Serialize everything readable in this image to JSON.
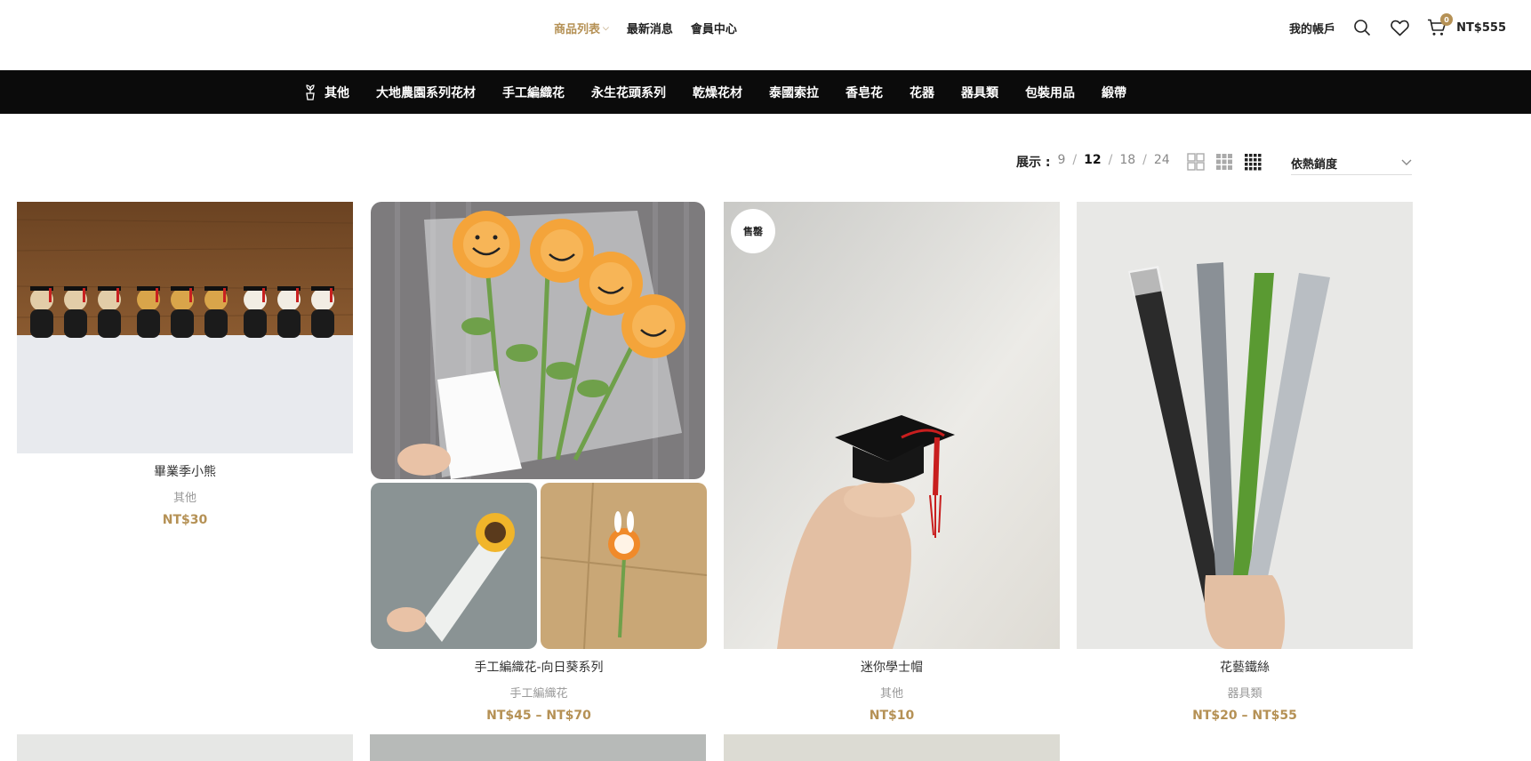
{
  "header": {
    "nav": [
      {
        "label": "商品列表",
        "active": true,
        "has_dropdown": true
      },
      {
        "label": "最新消息",
        "active": false
      },
      {
        "label": "會員中心",
        "active": false
      }
    ],
    "account_label": "我的帳戶",
    "cart_count": "0",
    "cart_total": "NT$555",
    "icons": [
      "search-icon",
      "heart-icon",
      "cart-icon"
    ]
  },
  "categories": [
    {
      "label": "其他",
      "icon": "plant-icon"
    },
    {
      "label": "大地農園系列花材"
    },
    {
      "label": "手工編織花"
    },
    {
      "label": "永生花頭系列"
    },
    {
      "label": "乾燥花材"
    },
    {
      "label": "泰國索拉"
    },
    {
      "label": "香皂花"
    },
    {
      "label": "花器"
    },
    {
      "label": "器具類"
    },
    {
      "label": "包裝用品"
    },
    {
      "label": "緞帶"
    }
  ],
  "toolbar": {
    "show_label": "展示 :",
    "per_page": [
      "9",
      "12",
      "18",
      "24"
    ],
    "active_per_page": "12",
    "sort_label": "依熱銷度"
  },
  "products": [
    {
      "title": "畢業季小熊",
      "category": "其他",
      "price": "NT$30",
      "badge": ""
    },
    {
      "title": "手工編織花-向日葵系列",
      "category": "手工編織花",
      "price": "NT$45 – NT$70",
      "badge": ""
    },
    {
      "title": "迷你學士帽",
      "category": "其他",
      "price": "NT$10",
      "badge": "售罄"
    },
    {
      "title": "花藝鐵絲",
      "category": "器具類",
      "price": "NT$20 – NT$55",
      "badge": ""
    }
  ],
  "colors": {
    "accent": "#b59155",
    "catbar": "#0b0b0b"
  }
}
